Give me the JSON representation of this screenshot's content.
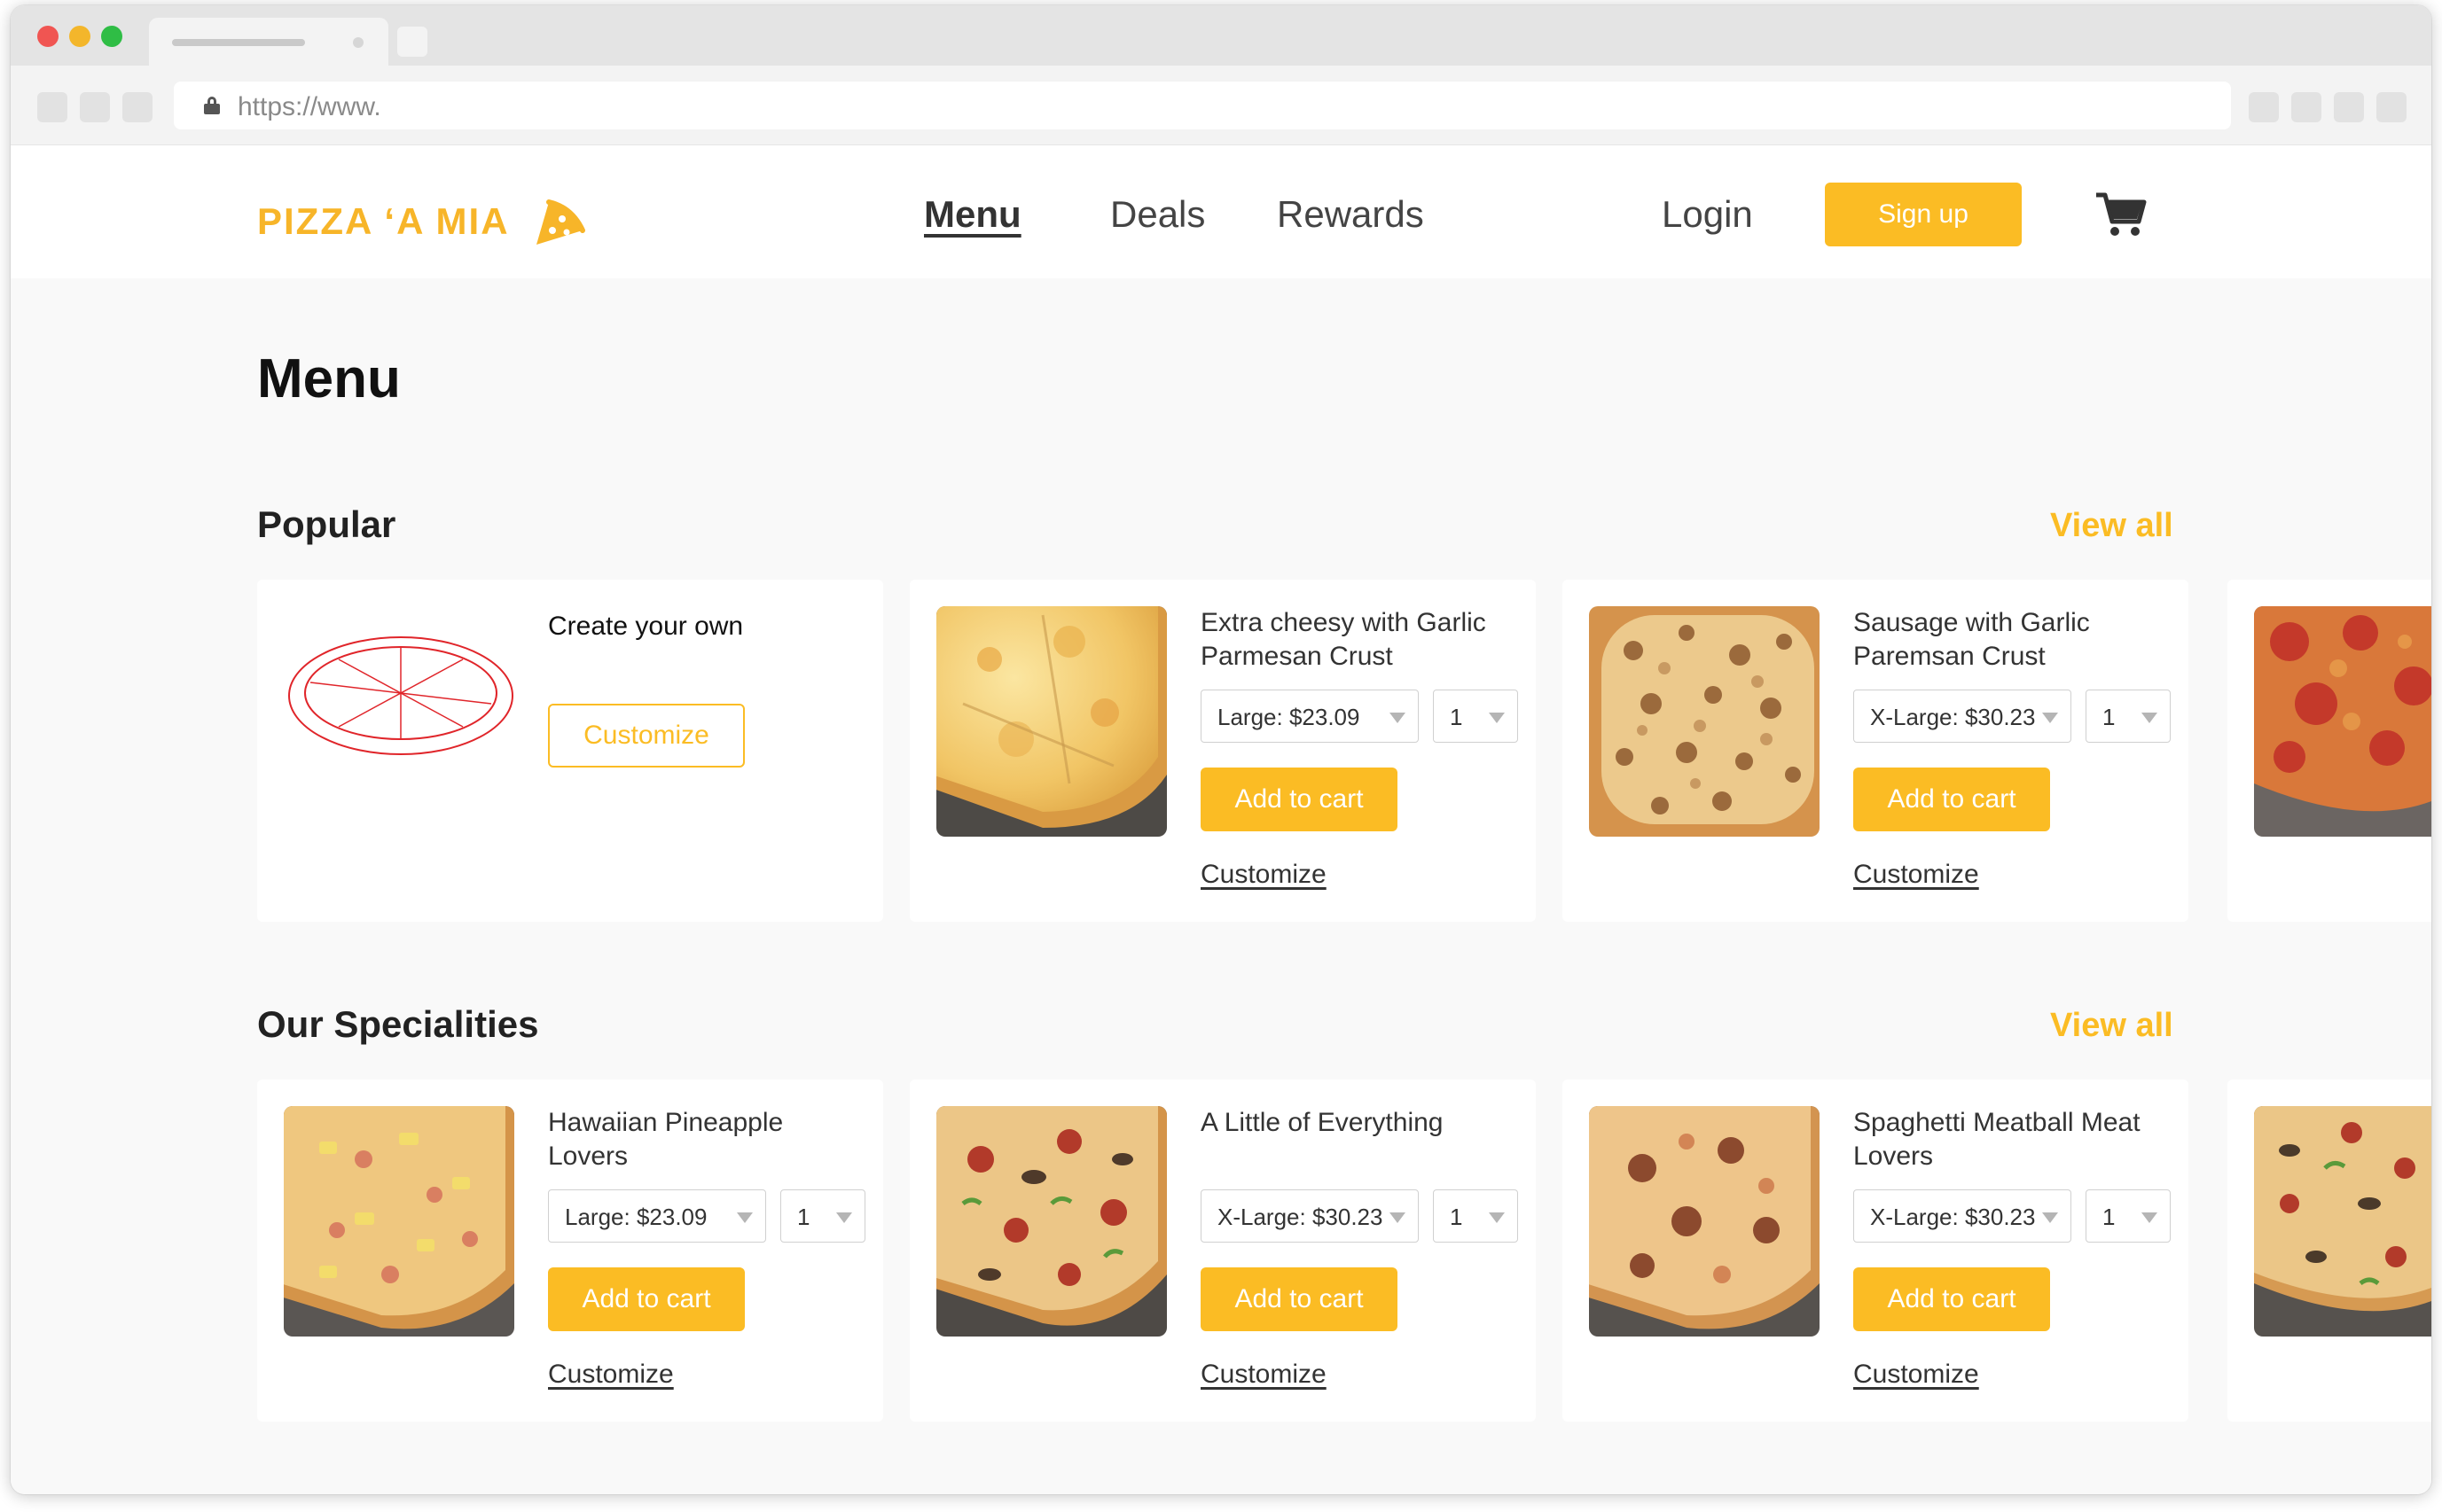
{
  "browser": {
    "url": "https://www."
  },
  "header": {
    "logo": "PIZZA ‘A MIA",
    "nav": {
      "menu": "Menu",
      "deals": "Deals",
      "rewards": "Rewards"
    },
    "login": "Login",
    "signup": "Sign up",
    "icons": {
      "logo": "pizza-slice-icon",
      "cart": "shopping-cart-icon"
    }
  },
  "page": {
    "title": "Menu"
  },
  "colors": {
    "accent": "#fbbc24",
    "logo": "#f7b529",
    "outline_pizza": "#e0252a"
  },
  "popular": {
    "title": "Popular",
    "view_all": "View all",
    "create": {
      "name": "Create your own",
      "button": "Customize"
    },
    "items": [
      {
        "name": "Extra cheesy with Garlic Parmesan Crust",
        "size": "Large: $23.09",
        "qty": "1",
        "add": "Add to cart",
        "customize": "Customize"
      },
      {
        "name": "Sausage with Garlic Paremsan Crust",
        "size": "X-Large: $30.23",
        "qty": "1",
        "add": "Add to cart",
        "customize": "Customize"
      }
    ]
  },
  "specialities": {
    "title": "Our Specialities",
    "view_all": "View all",
    "items": [
      {
        "name": "Hawaiian Pineapple Lovers",
        "size": "Large: $23.09",
        "qty": "1",
        "add": "Add to cart",
        "customize": "Customize"
      },
      {
        "name": "A Little of Everything",
        "size": "X-Large: $30.23",
        "qty": "1",
        "add": "Add to cart",
        "customize": "Customize"
      },
      {
        "name": "Spaghetti Meatball Meat Lovers",
        "size": "X-Large: $30.23",
        "qty": "1",
        "add": "Add to cart",
        "customize": "Customize"
      }
    ]
  }
}
